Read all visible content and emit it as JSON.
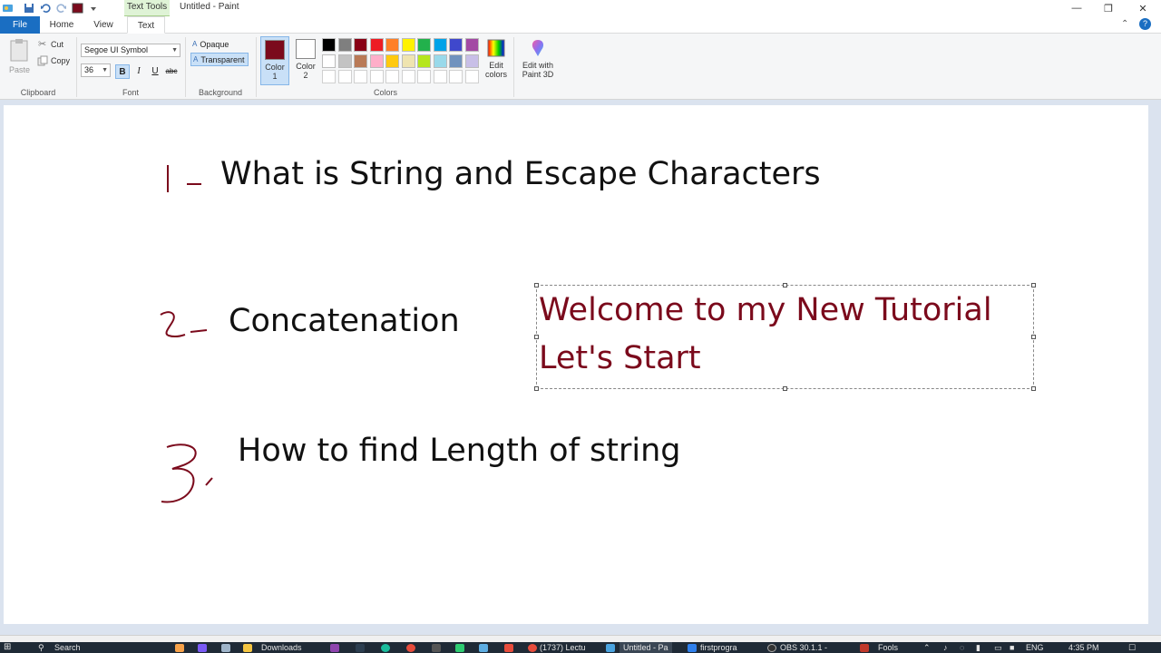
{
  "window": {
    "context_tab": "Text Tools",
    "title": "Untitled - Paint"
  },
  "tabs": {
    "file": "File",
    "home": "Home",
    "view": "View",
    "text": "Text"
  },
  "clipboard": {
    "paste": "Paste",
    "cut": "Cut",
    "copy": "Copy",
    "group": "Clipboard"
  },
  "font": {
    "family": "Segoe UI Symbol",
    "size": "36",
    "group": "Font",
    "bold": "B",
    "italic": "I",
    "underline": "U",
    "strike": "abc"
  },
  "background": {
    "opaque": "Opaque",
    "transparent": "Transparent",
    "group": "Background"
  },
  "colors": {
    "color1_label": "Color",
    "color1_num": "1",
    "color2_label": "Color",
    "color2_num": "2",
    "color1": "#7b0a1c",
    "color2": "#ffffff",
    "edit_line1": "Edit",
    "edit_line2": "colors",
    "group": "Colors",
    "palette": [
      "#000000",
      "#7f7f7f",
      "#880015",
      "#ed1c24",
      "#ff7f27",
      "#fff200",
      "#22b14c",
      "#00a2e8",
      "#3f48cc",
      "#a349a4",
      "#ffffff",
      "#c3c3c3",
      "#b97a57",
      "#ffaec9",
      "#ffc90e",
      "#efe4b0",
      "#b5e61d",
      "#99d9ea",
      "#7092be",
      "#c8bfe7",
      "#ffffff",
      "#ffffff",
      "#ffffff",
      "#ffffff",
      "#ffffff",
      "#ffffff",
      "#ffffff",
      "#ffffff",
      "#ffffff",
      "#ffffff"
    ]
  },
  "paint3d": {
    "line1": "Edit with",
    "line2": "Paint 3D"
  },
  "canvas": {
    "item1": "What is String and Escape Characters",
    "item2": "Concatenation",
    "item3": "How to find Length of string",
    "textbox_line1": "Welcome to my New Tutorial",
    "textbox_line2": "Let's Start"
  },
  "taskbar": {
    "search": "Search",
    "downloads": "Downloads",
    "lecture": "(1737) Lectu",
    "paint": "Untitled - Pa",
    "firstprog": "firstprogra",
    "obs": "OBS 30.1.1 -",
    "fools": "Fools",
    "lang": "ENG",
    "time": "4:35 PM"
  }
}
